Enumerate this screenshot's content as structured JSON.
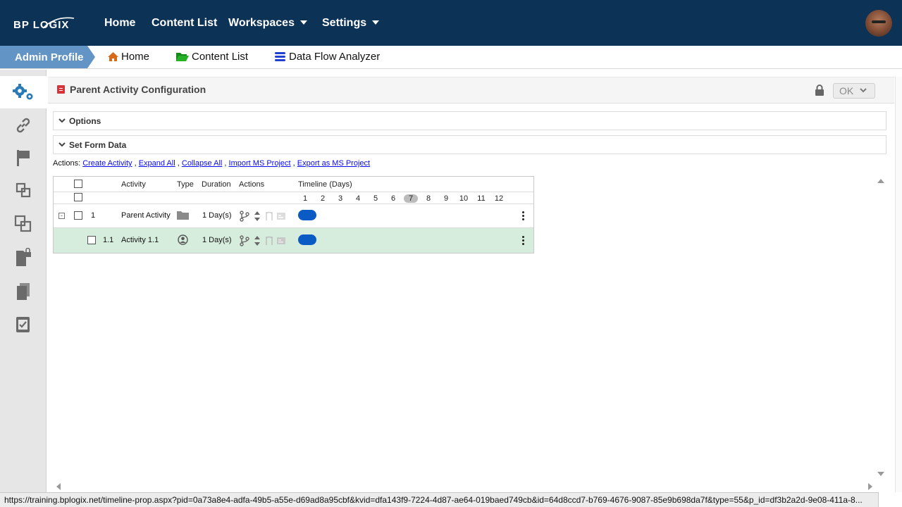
{
  "topnav": {
    "logo": "BP LOGIX",
    "logo_bp": "BP",
    "items": [
      {
        "label": "Home"
      },
      {
        "label": "Content List"
      },
      {
        "label": "Workspaces"
      },
      {
        "label": "Settings"
      }
    ]
  },
  "breadcrumb": {
    "profile": "Admin Profile",
    "items": [
      {
        "label": "Home",
        "icon": "home-icon",
        "color": "#d9691a"
      },
      {
        "label": "Content List",
        "icon": "folder-open-icon",
        "color": "#1fa31f"
      },
      {
        "label": "Data Flow Analyzer",
        "icon": "database-icon",
        "color": "#1f3fd0"
      }
    ]
  },
  "sidebar": {
    "items": [
      {
        "icon": "gears-icon",
        "active": true
      },
      {
        "icon": "link-icon"
      },
      {
        "icon": "flag-icon"
      },
      {
        "icon": "nested-squares-icon"
      },
      {
        "icon": "overlap-squares-icon"
      },
      {
        "icon": "locked-document-icon"
      },
      {
        "icon": "copy-documents-icon"
      },
      {
        "icon": "checklist-icon"
      }
    ]
  },
  "panel": {
    "title": "Parent Activity Configuration",
    "ok_label": "OK"
  },
  "sections": {
    "options": "Options",
    "set_form_data": "Set Form Data"
  },
  "actions": {
    "prefix": "Actions:",
    "links": [
      "Create Activity",
      "Expand All",
      "Collapse All",
      "Import MS Project",
      "Export as MS Project"
    ],
    "separator": ","
  },
  "grid": {
    "headers": {
      "activity": "Activity",
      "type": "Type",
      "duration": "Duration",
      "actions": "Actions",
      "timeline": "Timeline (Days)"
    },
    "days": [
      "1",
      "2",
      "3",
      "4",
      "5",
      "6",
      "7",
      "8",
      "9",
      "10",
      "11",
      "12"
    ],
    "today_day": "7",
    "rows": [
      {
        "id": "1",
        "name": "Parent Activity",
        "type_icon": "folder-icon",
        "duration": "1 Day(s)",
        "collapse": "-"
      },
      {
        "id": "1.1",
        "name": "Activity 1.1",
        "type_icon": "user-icon",
        "duration": "1 Day(s)"
      }
    ]
  },
  "status": {
    "url": "https://training.bplogix.net/timeline-prop.aspx?pid=0a73a8e4-adfa-49b5-a55e-d69ad8a95cbf&kvid=dfa143f9-7224-4d87-ae64-019baed749cb&id=64d8ccd7-b769-4676-9087-85e9b698da7f&type=55&p_id=df3b2a2d-9e08-411a-8..."
  },
  "colors": {
    "topnav": "#0c3256",
    "profile_tab": "#6294c5",
    "timeline_bar": "#0b5bc4",
    "selected_row": "#d6ecdc"
  }
}
